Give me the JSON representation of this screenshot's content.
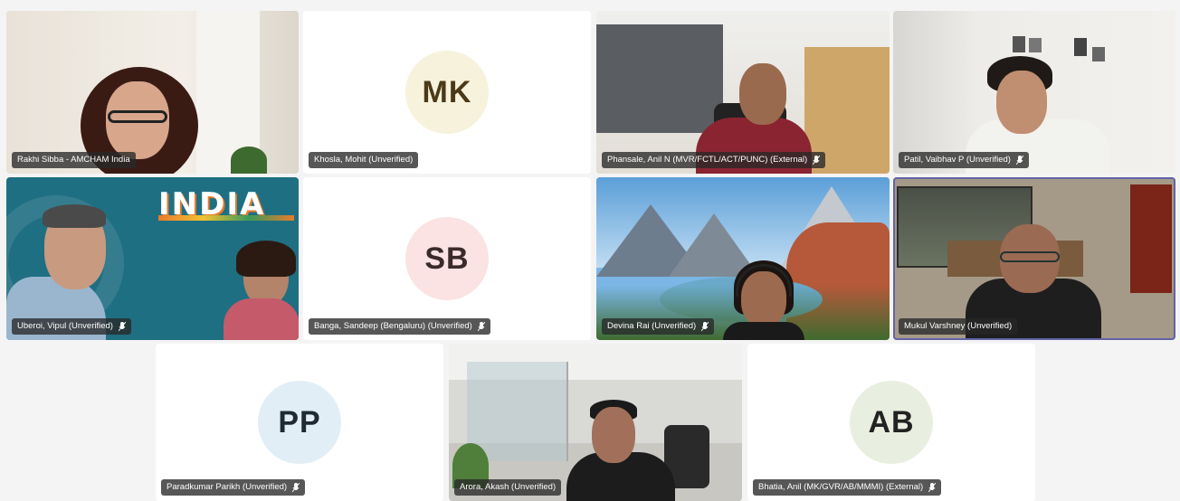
{
  "participants": [
    {
      "id": "p1",
      "name": "Rakhi Sibba - AMCHAM India",
      "muted": false,
      "type": "video"
    },
    {
      "id": "p2",
      "name": "Khosla, Mohit (Unverified)",
      "muted": false,
      "type": "avatar",
      "initials": "MK",
      "avatar_bg": "#f7f2dc",
      "avatar_fg": "#4a3a1a"
    },
    {
      "id": "p3",
      "name": "Phansale, Anil N (MVR/FCTL/ACT/PUNC) (External)",
      "muted": true,
      "type": "video"
    },
    {
      "id": "p4",
      "name": "Patil, Vaibhav P (Unverified)",
      "muted": true,
      "type": "video"
    },
    {
      "id": "p5",
      "name": "Uberoi, Vipul (Unverified)",
      "muted": true,
      "type": "video",
      "background_text": "INDIA"
    },
    {
      "id": "p6",
      "name": "Banga, Sandeep (Bengaluru) (Unverified)",
      "muted": true,
      "type": "avatar",
      "initials": "SB",
      "avatar_bg": "#fbe3e3",
      "avatar_fg": "#3a2a2a"
    },
    {
      "id": "p7",
      "name": "Devina Rai (Unverified)",
      "muted": true,
      "type": "video"
    },
    {
      "id": "p8",
      "name": "Mukul Varshney (Unverified)",
      "muted": false,
      "type": "video",
      "active_speaker": true
    },
    {
      "id": "p9",
      "name": "Paradkumar Parikh (Unverified)",
      "muted": true,
      "type": "avatar",
      "initials": "PP",
      "avatar_bg": "#e2eef6",
      "avatar_fg": "#1f2a33"
    },
    {
      "id": "p10",
      "name": "Arora, Akash (Unverified)",
      "muted": false,
      "type": "video"
    },
    {
      "id": "p11",
      "name": "Bhatia, Anil (MK/GVR/AB/MMMI) (External)",
      "muted": true,
      "type": "avatar",
      "initials": "AB",
      "avatar_bg": "#e9efe0",
      "avatar_fg": "#222"
    }
  ],
  "colors": {
    "active_border": "#6264a7",
    "nameplate_bg": "#282828"
  }
}
